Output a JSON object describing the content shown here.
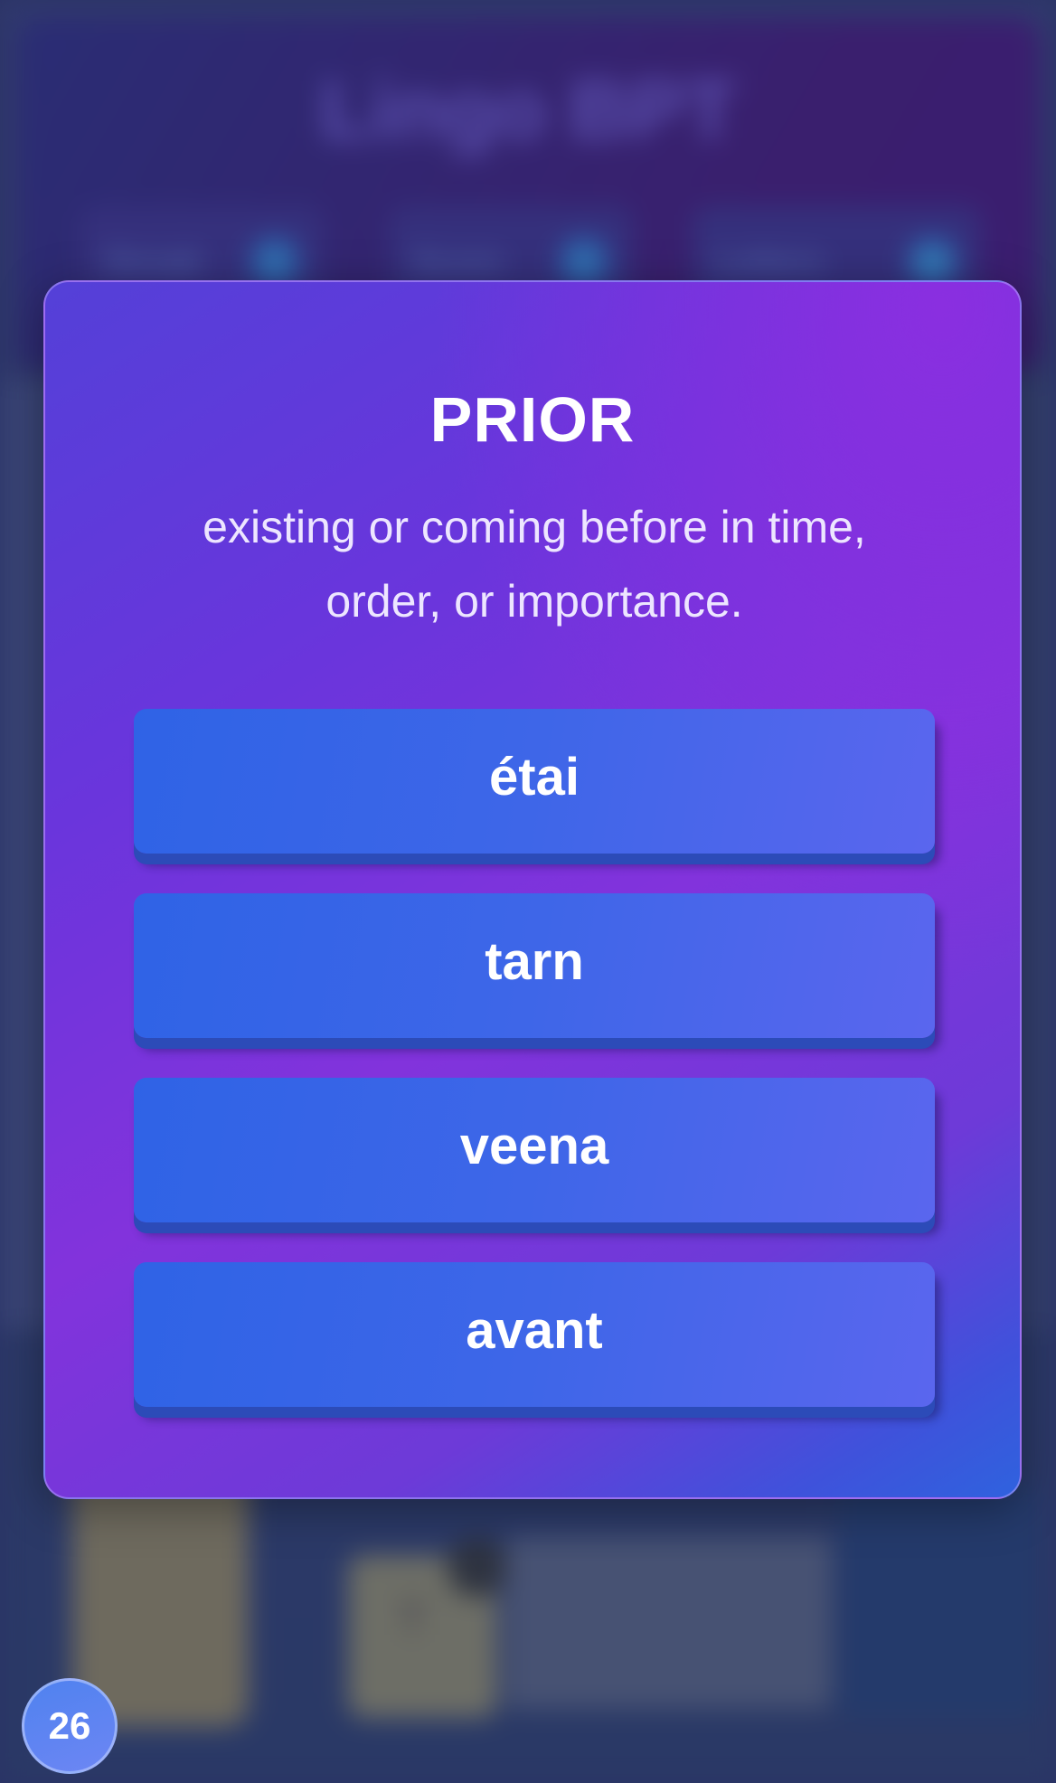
{
  "background": {
    "app_title": "Lingo BPT",
    "stats": [
      {
        "label": "Streak",
        "value": "0"
      },
      {
        "label": "Score",
        "value": "0"
      },
      {
        "label": "Letters",
        "value": "26"
      }
    ],
    "tile_letter": "T"
  },
  "quiz": {
    "word": "PRIOR",
    "definition": "existing or coming before in time, order, or importance.",
    "options": [
      {
        "label": "étai"
      },
      {
        "label": "tarn"
      },
      {
        "label": "veena"
      },
      {
        "label": "avant"
      }
    ]
  },
  "counter": {
    "value": "26"
  },
  "colors": {
    "modal_gradient_start": "#5440d8",
    "modal_gradient_mid": "#8233dc",
    "modal_gradient_end": "#2f62de",
    "option_button": "#3e66e8",
    "option_shadow": "#2c4bb8",
    "counter_badge": "#5f84f2"
  }
}
